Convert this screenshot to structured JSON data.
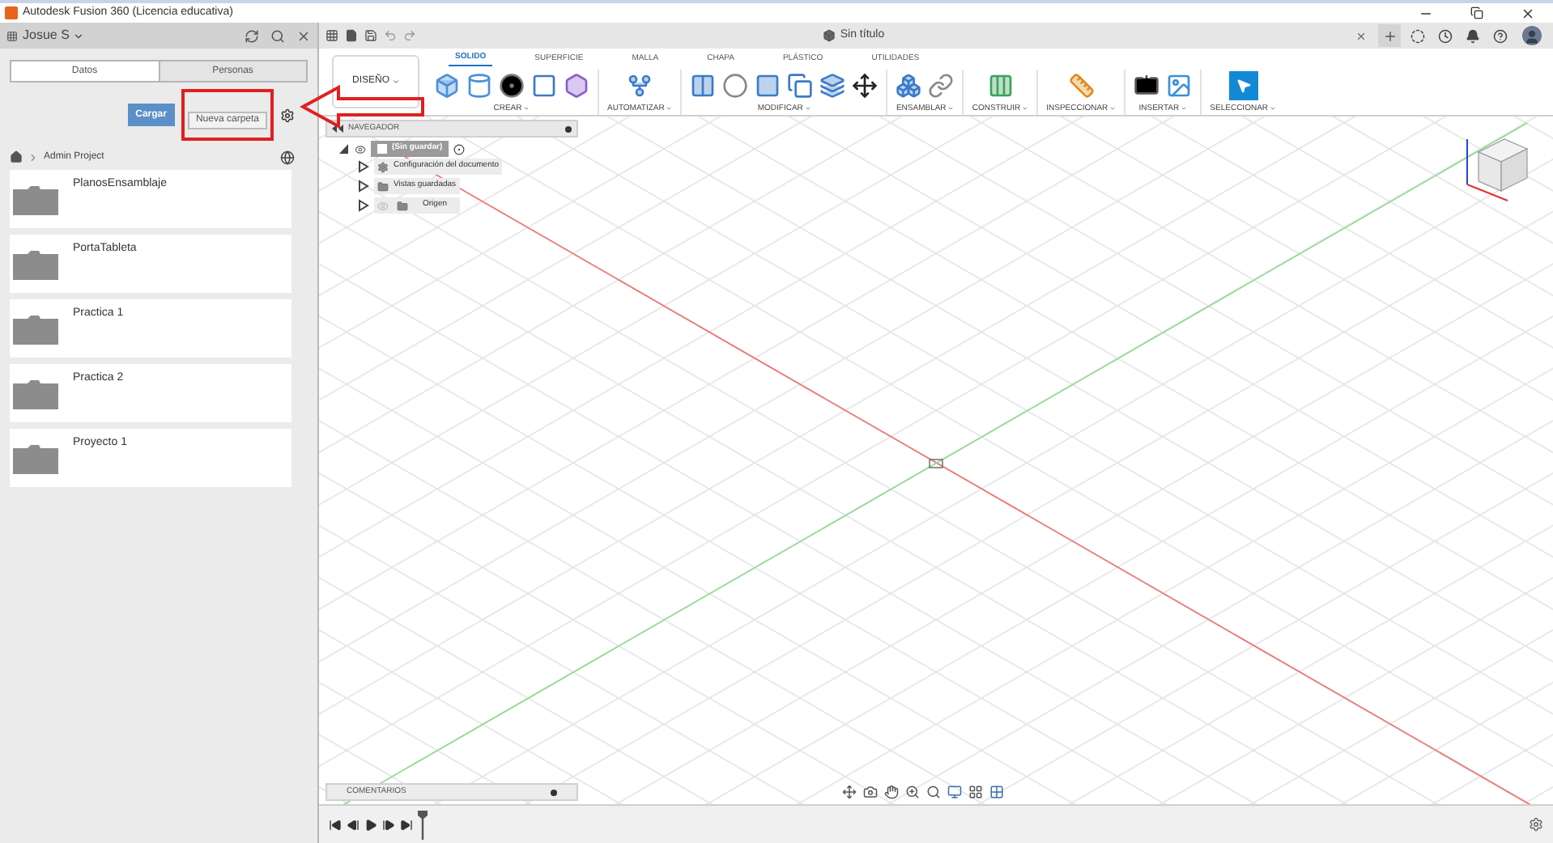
{
  "window": {
    "title": "Autodesk Fusion 360 (Licencia educativa)"
  },
  "left_panel": {
    "user": "Josue S",
    "tabs": [
      {
        "label": "Datos",
        "selected": true
      },
      {
        "label": "Personas",
        "selected": false
      }
    ],
    "upload_button": "Cargar",
    "new_folder_button": "Nueva carpeta",
    "breadcrumb": "Admin Project",
    "folders": [
      {
        "name": "PlanosEnsamblaje"
      },
      {
        "name": "PortaTableta"
      },
      {
        "name": "Practica 1"
      },
      {
        "name": "Practica 2"
      },
      {
        "name": "Proyecto 1"
      }
    ]
  },
  "document_tab": "Sin título",
  "workspace": "DISEÑO",
  "ribbon_tabs": [
    {
      "label": "SOLIDO",
      "selected": true
    },
    {
      "label": "SUPERFICIE",
      "selected": false
    },
    {
      "label": "MALLA",
      "selected": false
    },
    {
      "label": "CHAPA",
      "selected": false
    },
    {
      "label": "PLÁSTICO",
      "selected": false
    },
    {
      "label": "UTILIDADES",
      "selected": false
    }
  ],
  "ribbon_groups": [
    {
      "label": "CREAR"
    },
    {
      "label": "AUTOMATIZAR"
    },
    {
      "label": "MODIFICAR"
    },
    {
      "label": "ENSAMBLAR"
    },
    {
      "label": "CONSTRUIR"
    },
    {
      "label": "INSPECCIONAR"
    },
    {
      "label": "INSERTAR"
    },
    {
      "label": "SELECCIONAR"
    }
  ],
  "navigator": {
    "title": "NAVEGADOR",
    "root": {
      "label": "(Sin guardar)",
      "expanded": true,
      "children": [
        {
          "kind": "settings",
          "label": "Configuración del documento",
          "expanded": false
        },
        {
          "kind": "folder",
          "label": "Vistas guardadas",
          "expanded": false
        },
        {
          "kind": "visible-folder",
          "label": "Origen",
          "expanded": false
        }
      ]
    }
  },
  "comments": "COMENTARIOS"
}
